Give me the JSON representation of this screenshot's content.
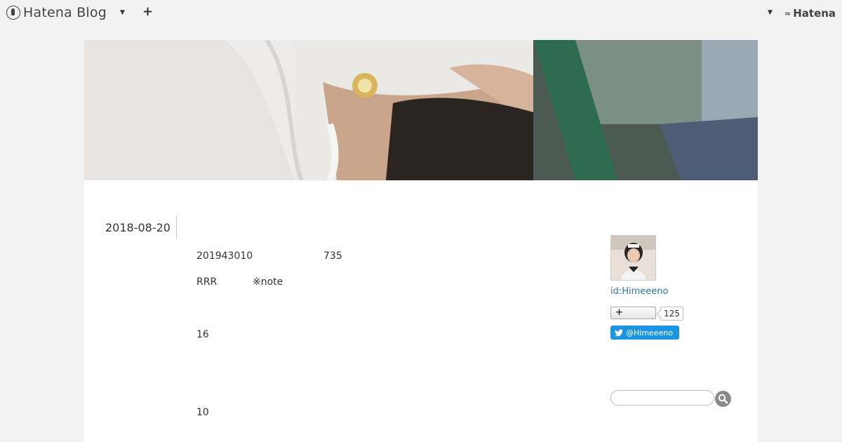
{
  "global_header": {
    "brand": "Hatena Blog",
    "add_label": "+",
    "hatena_label": "Hatena"
  },
  "entry": {
    "date": "2018-08-20",
    "lines": [
      {
        "a": "201943010",
        "b": "735"
      },
      {
        "a": "RRR",
        "b": "※note"
      },
      {
        "a": "16",
        "b": ""
      },
      {
        "a": "10",
        "b": ""
      }
    ]
  },
  "sidebar": {
    "profile_id": "id:Himeeeno",
    "follow_label": "+",
    "follower_count": "125",
    "twitter_handle": "@Himeeeno",
    "search_placeholder": ""
  },
  "colors": {
    "link": "#3073a8",
    "twitter": "#1b95e0"
  }
}
